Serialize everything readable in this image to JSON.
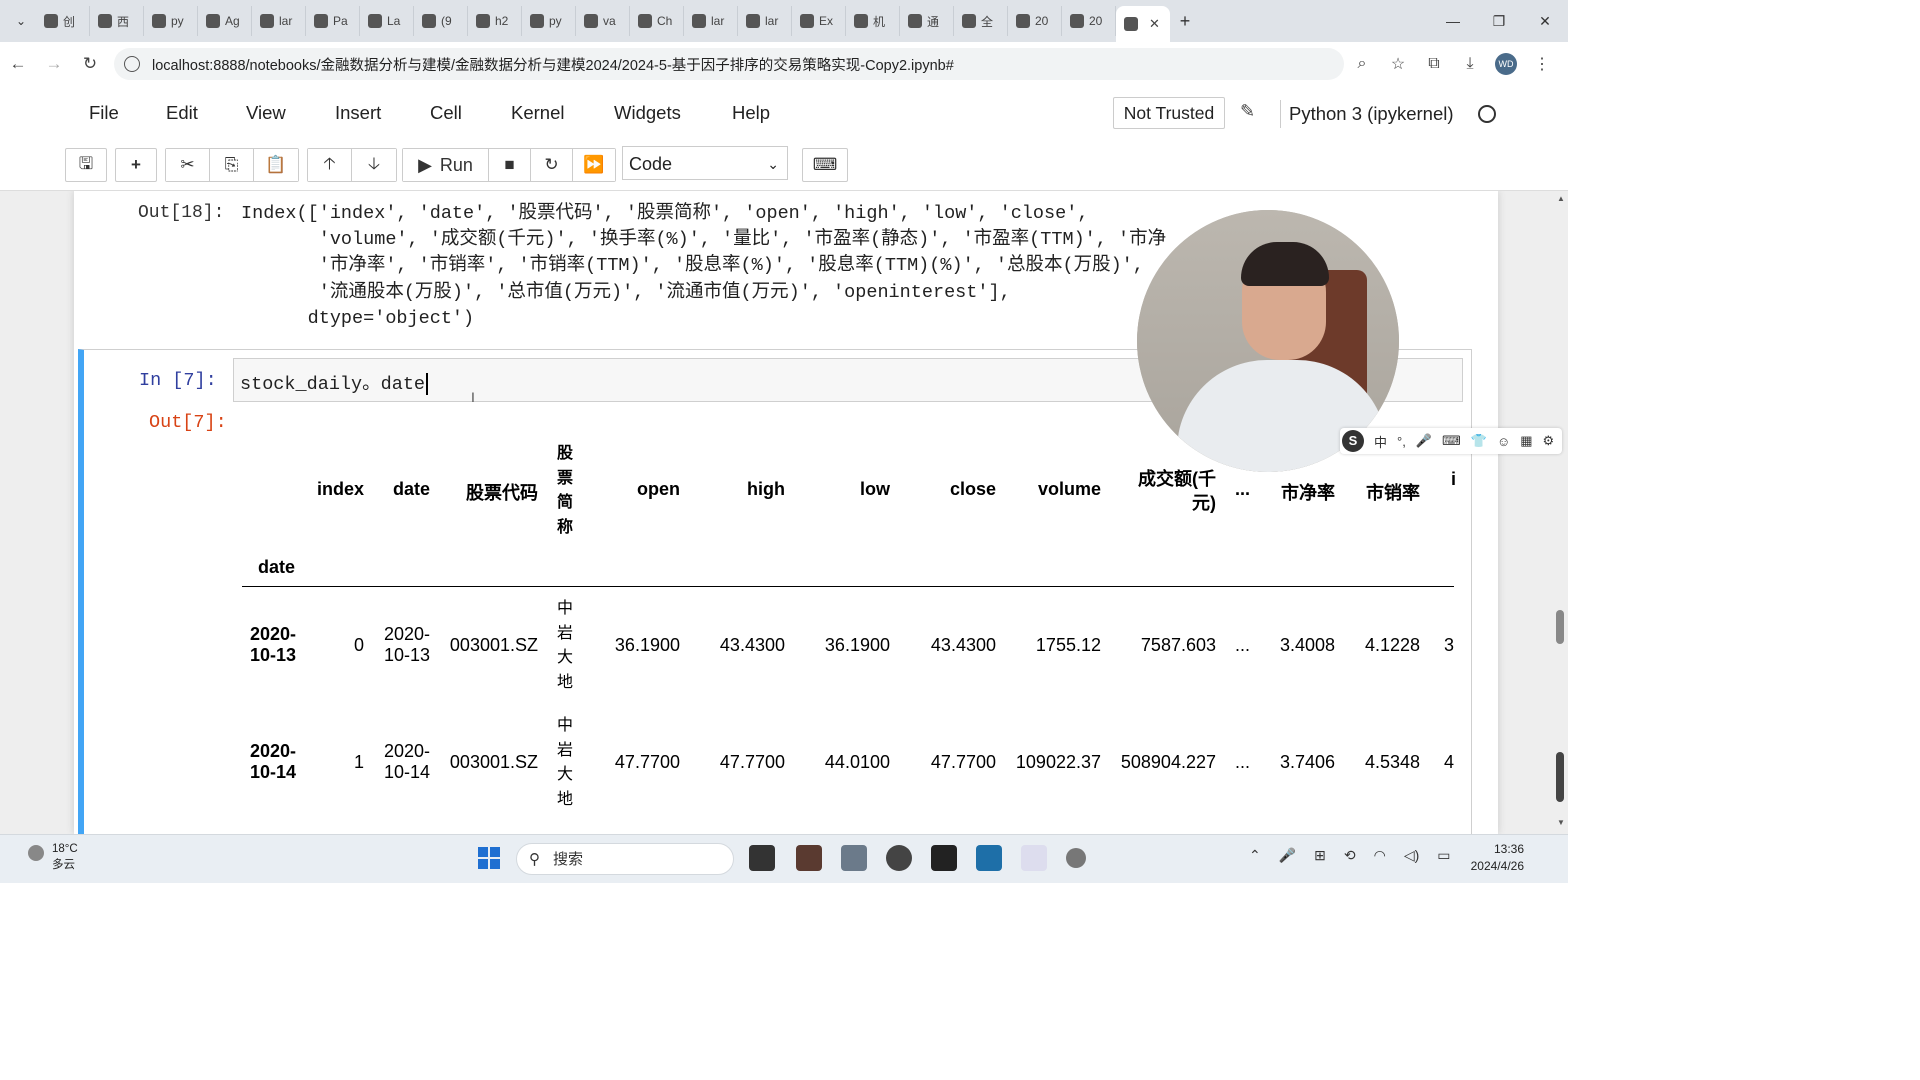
{
  "browser": {
    "tabs": [
      "创",
      "西",
      "py",
      "Ag",
      "lar",
      "Pa",
      "La",
      "(9",
      "h2",
      "py",
      "va",
      "Ch",
      "lar",
      "lar",
      "Ex",
      "机",
      "通",
      "全",
      "20",
      "20",
      ""
    ],
    "active_tab_index": 20,
    "url": "localhost:8888/notebooks/金融数据分析与建模/金融数据分析与建模2024/2024-5-基于因子排序的交易策略实现-Copy2.ipynb#",
    "profile_initials": "WD"
  },
  "jupyter": {
    "menu": [
      "File",
      "Edit",
      "View",
      "Insert",
      "Cell",
      "Kernel",
      "Widgets",
      "Help"
    ],
    "trusted": "Not Trusted",
    "kernel": "Python 3 (ipykernel)",
    "run_label": "Run",
    "cell_type": "Code"
  },
  "out18": {
    "prompt": "Out[18]:",
    "text": "Index(['index', 'date', '股票代码', '股票简称', 'open', 'high', 'low', 'close',\n       'volume', '成交额(千元)', '换手率(%)', '量比', '市盈率(静态)', '市盈率(TTM)', '市净\n       '市净率', '市销率', '市销率(TTM)', '股息率(%)', '股息率(TTM)(%)', '总股本(万股)',\n       '流通股本(万股)', '总市值(万元)', '流通市值(万元)', 'openinterest'],\n      dtype='object')"
  },
  "cell7": {
    "in_prompt": "In  [7]:",
    "code": "stock_daily。date",
    "out_prompt": "Out[7]:"
  },
  "table": {
    "index_name": "date",
    "columns": [
      "index",
      "date",
      "股票代码",
      "股票简称",
      "open",
      "high",
      "low",
      "close",
      "volume",
      "成交额(千元)",
      "...",
      "市净率",
      "市销率",
      "i"
    ],
    "rows": [
      {
        "idx": "2020-10-13",
        "index": "0",
        "date": "2020-10-13",
        "code": "003001.SZ",
        "name": "中岩大地",
        "open": "36.1900",
        "high": "43.4300",
        "low": "36.1900",
        "close": "43.4300",
        "volume": "1755.12",
        "amount": "7587.603",
        "ell": "...",
        "pb": "3.4008",
        "ps": "4.1228",
        "more": "3"
      },
      {
        "idx": "2020-10-14",
        "index": "1",
        "date": "2020-10-14",
        "code": "003001.SZ",
        "name": "中岩大地",
        "open": "47.7700",
        "high": "47.7700",
        "low": "44.0100",
        "close": "47.7700",
        "volume": "109022.37",
        "amount": "508904.227",
        "ell": "...",
        "pb": "3.7406",
        "ps": "4.5348",
        "more": "4"
      }
    ]
  },
  "ime": {
    "lang": "中"
  },
  "taskbar": {
    "temp": "18°C",
    "weather": "多云",
    "search_placeholder": "搜索",
    "time": "13:36",
    "date": "2024/4/26"
  },
  "colors": {
    "edit_border": "#42a5f5",
    "out_prompt": "#d84315",
    "in_prompt": "#303f9f"
  }
}
